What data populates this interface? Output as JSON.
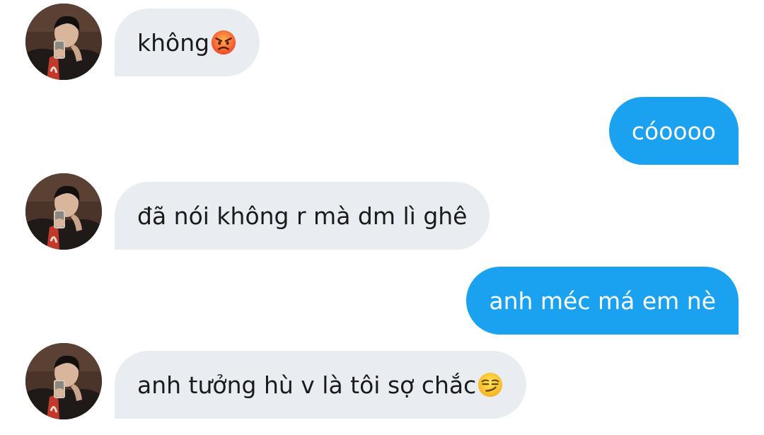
{
  "messages": [
    {
      "sender": "them",
      "text": "không",
      "emoji": "angry-face-emoji"
    },
    {
      "sender": "me",
      "text": "cóoooo"
    },
    {
      "sender": "them",
      "text": "đã nói không r mà dm lì ghê"
    },
    {
      "sender": "me",
      "text": "anh méc má em nè"
    },
    {
      "sender": "them",
      "text": "anh tưởng hù v là tôi sợ chắc",
      "emoji": "smirking-face-emoji"
    }
  ],
  "colors": {
    "incoming_bubble": "#e9edf1",
    "outgoing_bubble": "#1aa1f0",
    "incoming_text": "#1b1b1b",
    "outgoing_text": "#ffffff"
  }
}
